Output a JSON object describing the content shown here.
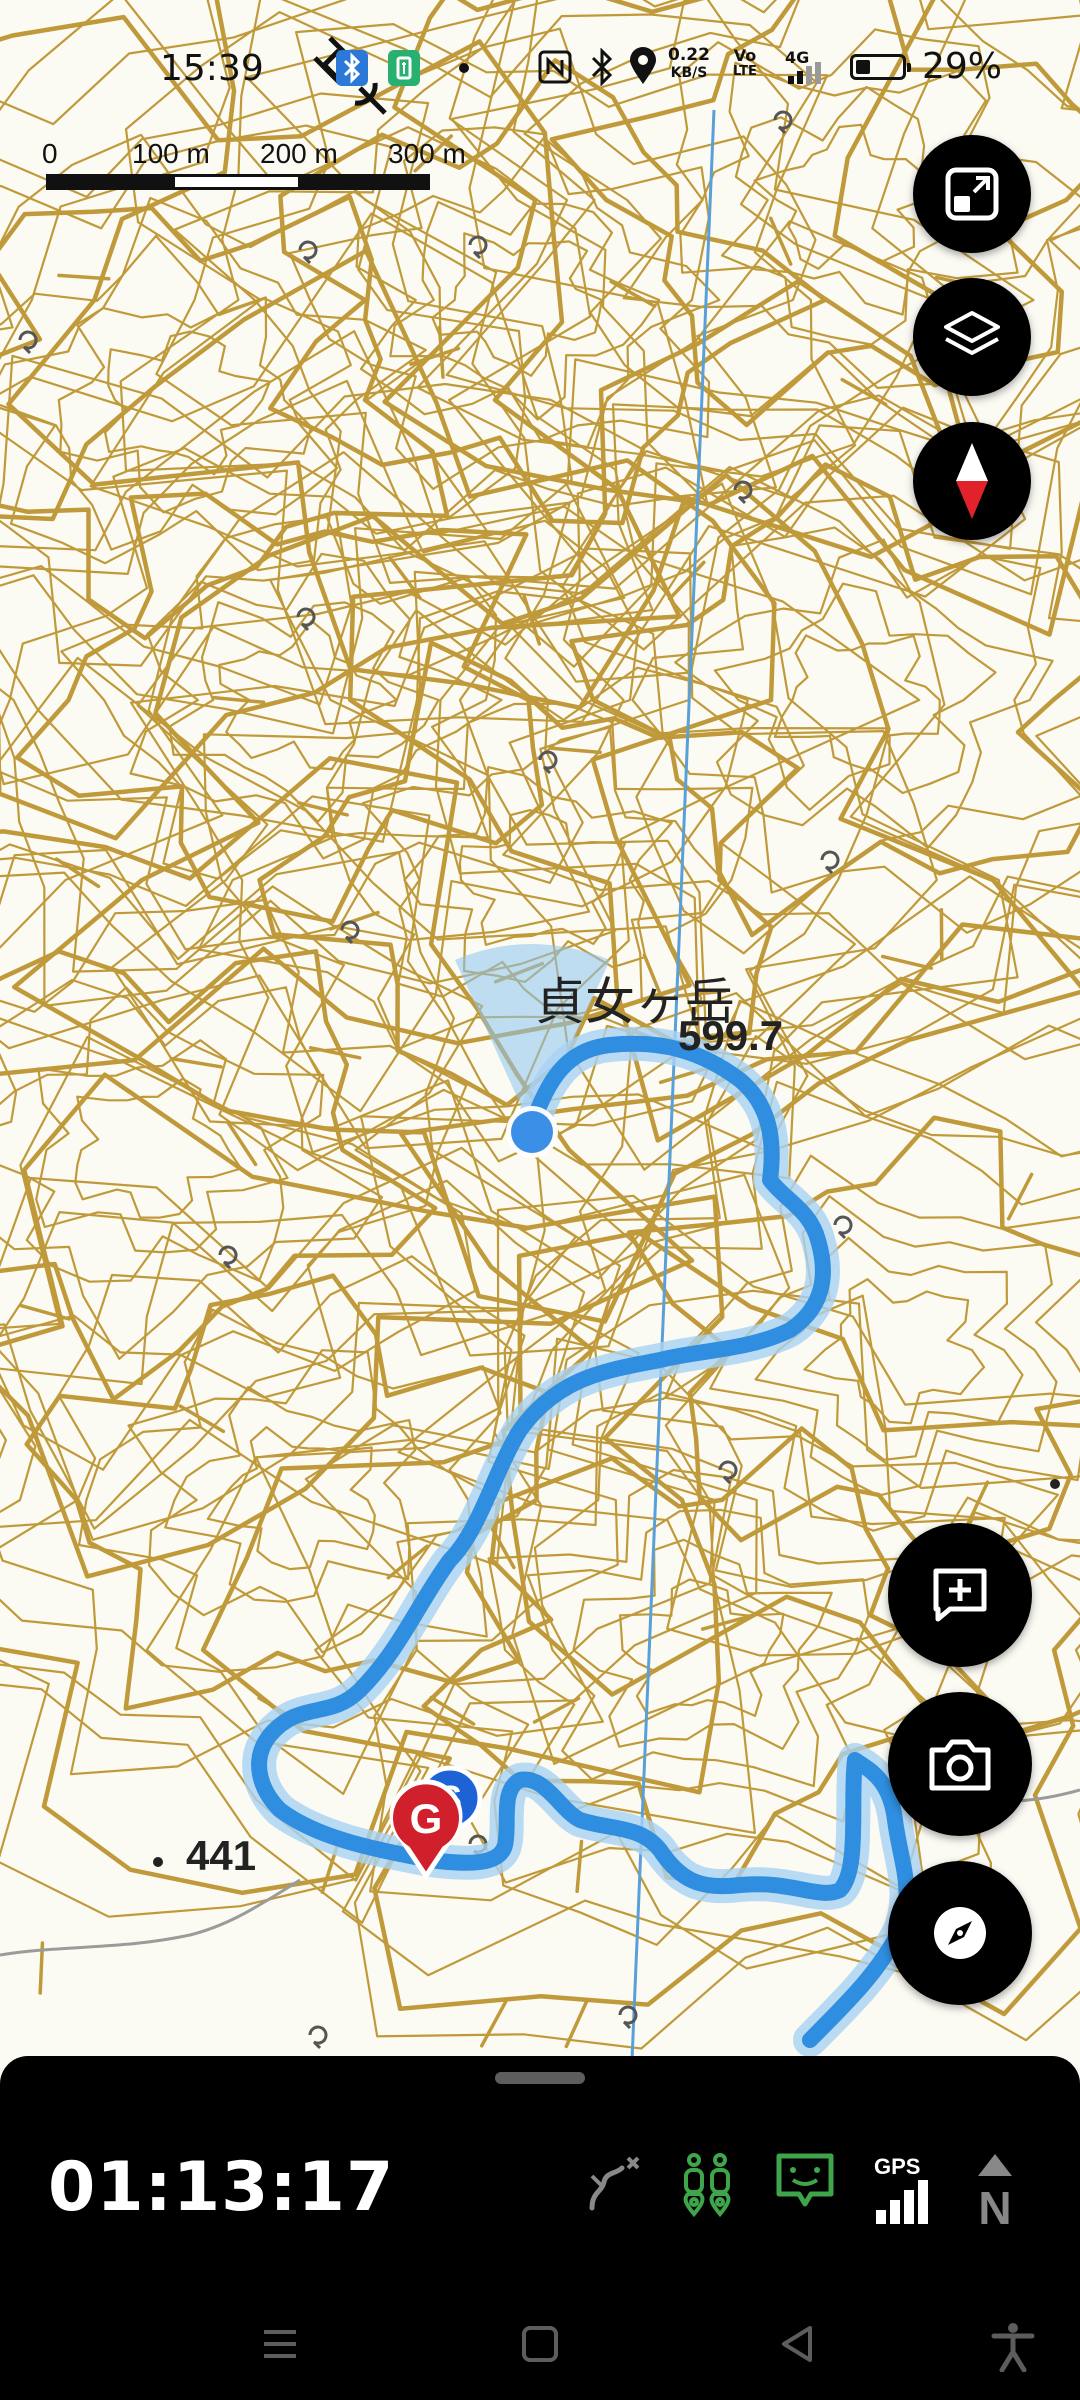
{
  "status_bar": {
    "time": "15:39",
    "net_speed_value": "0.22",
    "net_speed_unit": "KB/S",
    "volte_top": "Vo",
    "volte_bottom": "LTE",
    "signal_type": "4G",
    "battery_percent": "29%",
    "battery_level": 0.29,
    "icons": [
      "satellite-icon",
      "bluetooth-app-icon",
      "battery-saver-app-icon",
      "notification-dot-icon",
      "nfc-icon",
      "bluetooth-icon",
      "location-icon",
      "network-speed-icon",
      "volte-icon",
      "signal-icon",
      "battery-icon"
    ]
  },
  "scale_bar": {
    "labels": [
      "0",
      "100 m",
      "200 m",
      "300 m"
    ]
  },
  "map": {
    "peak_name": "貞女ヶ岳",
    "peak_elevation": "599.7",
    "spot_elevation": "441",
    "track_color": "#2f8ee0",
    "contour_color": "#c09a3a",
    "grid_line_color": "#5aa0d8",
    "current_location_color": "#3b8fe6",
    "start_marker_letter": "S",
    "goal_marker_letter": "G",
    "start_marker_color": "#1e63d6",
    "goal_marker_color": "#d0202b"
  },
  "map_controls": {
    "icons": [
      "fullscreen-toggle-icon",
      "layers-icon",
      "compass-needle-icon",
      "add-note-icon",
      "camera-icon",
      "navigate-icon"
    ]
  },
  "bottom_panel": {
    "elapsed_time": "01:13:17",
    "gps_label": "GPS",
    "north_label": "N",
    "icons": [
      "route-off-icon",
      "hikers-icon",
      "message-icon",
      "gps-signal-icon",
      "north-up-icon"
    ],
    "accent_green": "#3fa54a"
  },
  "system_nav": {
    "icons": [
      "menu-icon",
      "home-icon",
      "back-icon",
      "accessibility-icon"
    ]
  }
}
